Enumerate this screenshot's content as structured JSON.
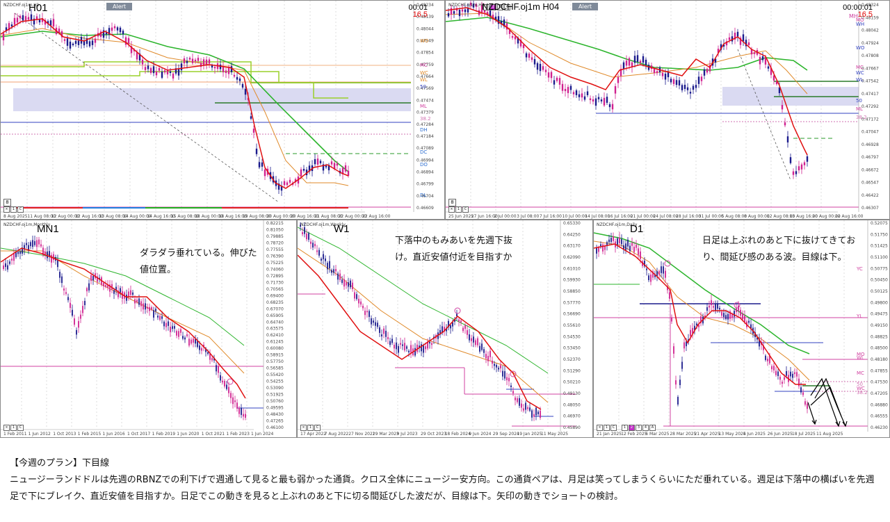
{
  "panels": {
    "h1": {
      "symbol": "NZDCHF.oj1m,H1",
      "timeframe": "H01",
      "alert": "Alert",
      "timer": "00:01",
      "spread": "16.5",
      "prices": [
        "0.48234",
        "0.48139",
        "0.48044",
        "0.47949",
        "0.47854",
        "0.47759",
        "0.47664",
        "0.47569",
        "0.47474",
        "0.47379",
        "0.47284",
        "0.47184",
        "0.47089",
        "0.46994",
        "0.46894",
        "0.46799",
        "0.46704",
        "0.46609"
      ],
      "price_tag": "0.46928",
      "levels": [
        "WO",
        "MC",
        "WC",
        "WL",
        "50",
        "ML",
        "38.2",
        "DH",
        "DC",
        "DO",
        "DL"
      ],
      "dates": [
        "8 Aug 2025",
        "11 Aug 08:00",
        "12 Aug 00:00",
        "12 Aug 16:00",
        "13 Aug 08:00",
        "14 Aug 00:00",
        "14 Aug 16:00",
        "15 Aug 08:00",
        "18 Aug 00:00",
        "18 Aug 16:00",
        "19 Aug 08:00",
        "20 Aug 00:00",
        "20 Aug 16:00",
        "21 Aug 08:00",
        "22 Aug 00:00",
        "22 Aug 16:00"
      ]
    },
    "h4": {
      "symbol": "NZDCHF.oj1m,H4",
      "timeframe": "NZDCHF.oj1m H04",
      "alert": "Alert",
      "timer": "00:00:01",
      "spread_prefix": "MH",
      "spread": "16.5",
      "tf_buttons": [
        "1",
        "2",
        "3",
        "4"
      ],
      "prices": [
        "0.48324",
        "0.48159",
        "0.48042",
        "0.47924",
        "0.47808",
        "0.47667",
        "0.47542",
        "0.47417",
        "0.47292",
        "0.47172",
        "0.47047",
        "0.46928",
        "0.46797",
        "0.46672",
        "0.46547",
        "0.46422",
        "0.46307"
      ],
      "levels": [
        "MO",
        "WH",
        "WO",
        "MC",
        "WC",
        "WL",
        "50",
        "ML",
        "38.2"
      ],
      "dates": [
        "25 Jun 2025",
        "27 Jun 16:00",
        "2 Jul 00:00",
        "3 Jul 08:00",
        "7 Jul 16:00",
        "10 Jul 00:00",
        "14 Jul 08:00",
        "16 Jul 16:00",
        "21 Jul 00:00",
        "24 Jul 08:00",
        "28 Jul 16:00",
        "31 Jul 00:00",
        "5 Aug 08:00",
        "8 Aug 00:00",
        "12 Aug 08:00",
        "15 Aug 16:00",
        "20 Aug 00:00",
        "22 Aug 16:00"
      ]
    },
    "mn1": {
      "symbol": "NZDCHF.oj1m,Monthly",
      "timeframe": "MN1",
      "note": [
        "ダラダラ垂れている。伸びた",
        "値位置。"
      ],
      "prices": [
        "0.82215",
        "0.81050",
        "0.79885",
        "0.78720",
        "0.77555",
        "0.76390",
        "0.75225",
        "0.74060",
        "0.72895",
        "0.71730",
        "0.70565",
        "0.69400",
        "0.68235",
        "0.67070",
        "0.65905",
        "0.64740",
        "0.63575",
        "0.62410",
        "0.61245",
        "0.60080",
        "0.58915",
        "0.57750",
        "0.56585",
        "0.55420",
        "0.54255",
        "0.53090",
        "0.51925",
        "0.50760",
        "0.49595",
        "0.48430",
        "0.47265",
        "0.46100"
      ],
      "price_tag": "0.46928",
      "dates": [
        "1 Feb 2011",
        "1 Jun 2012",
        "1 Oct 2013",
        "1 Feb 2015",
        "1 Jun 2016",
        "1 Oct 2017",
        "1 Feb 2019",
        "1 Jun 2020",
        "1 Oct 2021",
        "1 Feb 2023",
        "1 Jun 2024"
      ]
    },
    "w1": {
      "symbol": "NZDCHF.oj1m,Weekly",
      "timeframe": "W1",
      "note": [
        "下落中のもみあいを先週下抜",
        "け。直近安値付近を目指すか"
      ],
      "prices": [
        "0.65330",
        "0.64250",
        "0.63170",
        "0.62090",
        "0.61010",
        "0.59930",
        "0.58850",
        "0.57770",
        "0.56690",
        "0.55610",
        "0.54530",
        "0.53450",
        "0.52370",
        "0.51290",
        "0.50210",
        "0.49130",
        "0.48050",
        "0.46970",
        "0.45890"
      ],
      "price_tag": "0.46928",
      "dates": [
        "17 Apr 2022",
        "7 Aug 2022",
        "27 Nov 2022",
        "19 Mar 2023",
        "9 Jul 2023",
        "29 Oct 2023",
        "18 Feb 2024",
        "9 Jun 2024",
        "29 Sep 2024",
        "19 Jan 2025",
        "11 May 2025"
      ]
    },
    "d1": {
      "symbol": "NZDCHF.oj1m,Daily",
      "timeframe": "D1",
      "note": [
        "日足は上ぶれのあと下に抜けてきてお",
        "り、間延び感のある波。目線は下。"
      ],
      "tf_buttons": [
        "1",
        "2",
        "3",
        "4",
        "A"
      ],
      "prices": [
        "0.52075",
        "0.51750",
        "0.51425",
        "0.51100",
        "0.50775",
        "0.50450",
        "0.50125",
        "0.49800",
        "0.49475",
        "0.49150",
        "0.48825",
        "0.48500",
        "0.48180",
        "0.47855",
        "0.47530",
        "0.47205",
        "0.46880",
        "0.46555",
        "0.46230"
      ],
      "price_tag": "0.46928",
      "levels": [
        "YC",
        "YL",
        "MO",
        "WL",
        "MC",
        "50",
        "WC",
        "38.2"
      ],
      "dates": [
        "21 Jan 2025",
        "12 Feb 2025",
        "6 Mar 2025",
        "28 Mar 2025",
        "21 Apr 2025",
        "13 May 2025",
        "4 Jun 2025",
        "26 Jun 2025",
        "18 Jul 2025",
        "11 Aug 2025"
      ]
    }
  },
  "plan": {
    "title": "【今週のプラン】下目線",
    "body": "ニュージーランドドルは先週のRBNZでの利下げで週通して見ると最も弱かった通貨。クロス全体にニュージー安方向。この通貨ペアは、月足は笑ってしまうくらいにただ垂れている。週足は下落中の横ばいを先週足で下にブレイク、直近安値を目指すか。日足でこの動きを見ると上ぶれのあと下に切る間延びした波だが、目線は下。矢印の動きでショートの検討。"
  },
  "colors": {
    "bull_candle": "#1a1a8c",
    "bear_candle": "#d0208f",
    "fast_ma": "#e01010",
    "slow_ma": "#2db52d",
    "mid_ma": "#e08a2a",
    "level_magenta": "#d040a0",
    "level_blue": "#3040c0",
    "zone": "#d8d8f0"
  }
}
